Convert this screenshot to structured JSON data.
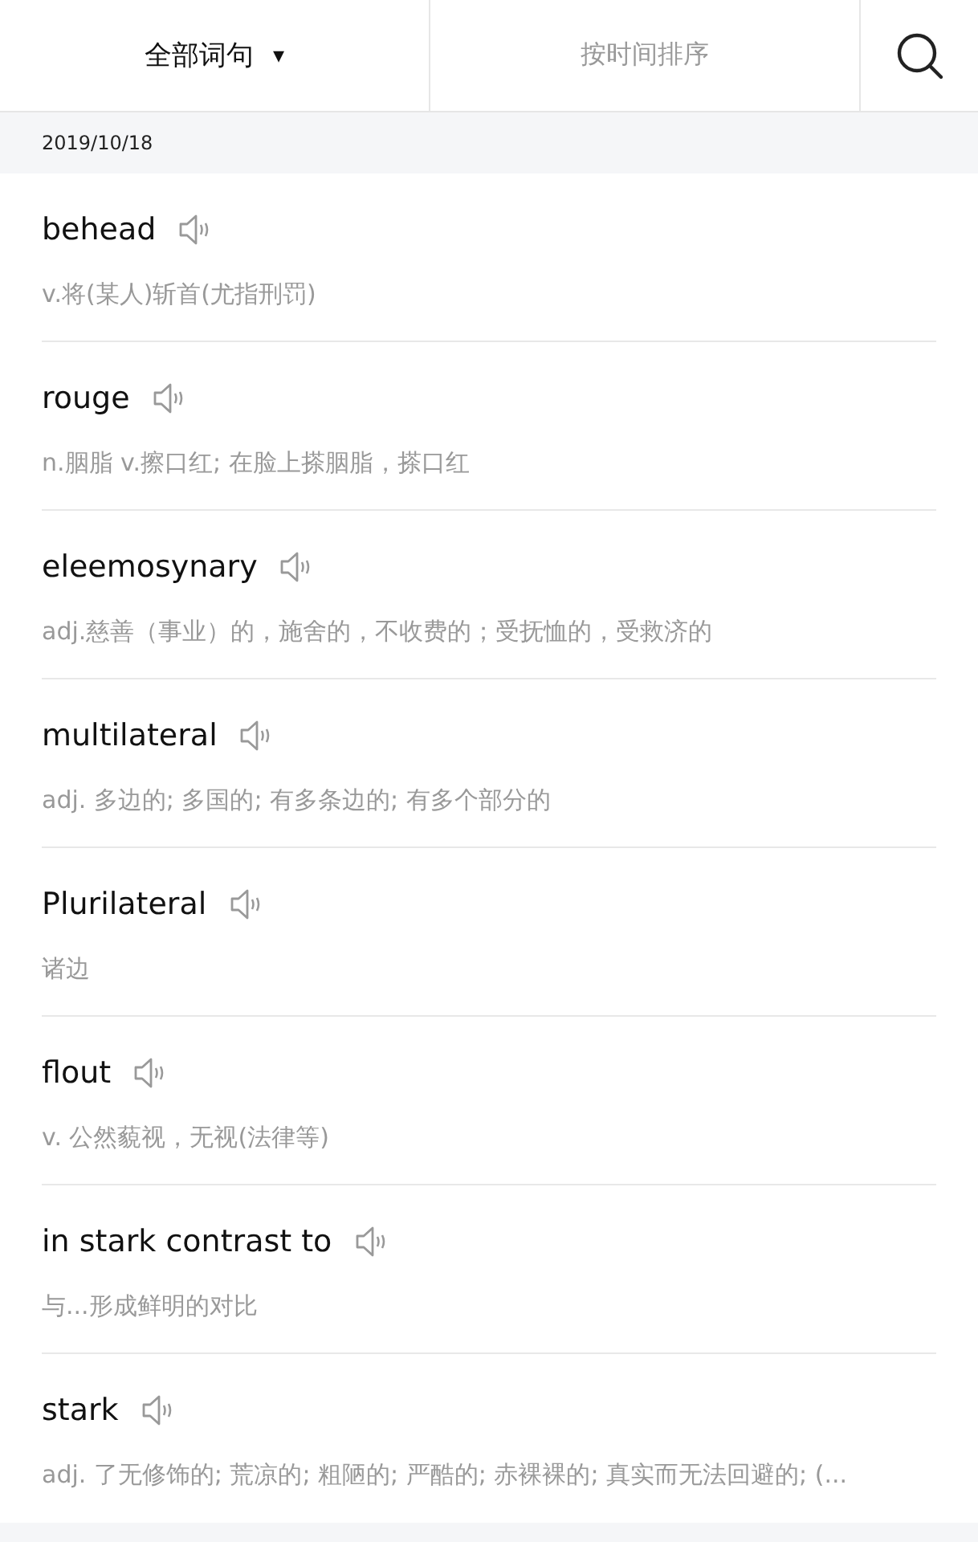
{
  "filter_menu": {
    "label": "全部词句",
    "caret": "▾"
  },
  "sort_tab": {
    "label": "按时间排序"
  },
  "date_header": "2019/10/18",
  "entries": [
    {
      "word": "behead",
      "definition": "v.将(某人)斩首(尤指刑罚)"
    },
    {
      "word": "rouge",
      "definition": "n.胭脂 v.擦口红; 在脸上搽胭脂，搽口红"
    },
    {
      "word": "eleemosynary",
      "definition": "adj.慈善（事业）的，施舍的，不收费的；受抚恤的，受救济的"
    },
    {
      "word": "multilateral",
      "definition": "adj. 多边的; 多国的; 有多条边的; 有多个部分的"
    },
    {
      "word": "Plurilateral",
      "definition": "诸边"
    },
    {
      "word": "flout",
      "definition": "v. 公然藐视，无视(法律等)"
    },
    {
      "word": "in stark contrast to",
      "definition": "与...形成鲜明的对比"
    },
    {
      "word": "stark",
      "definition": "adj. 了无修饰的; 荒凉的; 粗陋的; 严酷的; 赤裸裸的; 真实而无法回避的; (..."
    }
  ]
}
